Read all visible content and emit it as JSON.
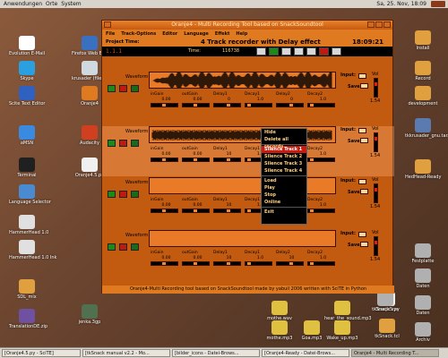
{
  "topbar": {
    "menus": [
      "Anwendungen",
      "Orte",
      "System"
    ],
    "clock": "Sa, 25. Nov, 18:09"
  },
  "desktop_icons": [
    {
      "label": "Evolution E-Mail",
      "color": "#ffffff"
    },
    {
      "label": "Skype",
      "color": "#2aa0e0"
    },
    {
      "label": "Scite Text Editor",
      "color": "#3060c0"
    },
    {
      "label": "aMSN",
      "color": "#3a8ae0"
    },
    {
      "label": "Terminal",
      "color": "#202020"
    },
    {
      "label": "Language Selector",
      "color": "#4a8ad0"
    },
    {
      "label": "HammerHead 1.0",
      "color": "#e0e0e0"
    },
    {
      "label": "HammerHead 1.0 Ink",
      "color": "#e0e0e0"
    },
    {
      "label": "SDL_mix",
      "color": "#e0a040"
    },
    {
      "label": "TranslationDE.zip",
      "color": "#7050a0"
    },
    {
      "label": "Firefox Web Browser",
      "color": "#3a70c0"
    },
    {
      "label": "krusader (file Manager)",
      "color": "#d0d8e0"
    },
    {
      "label": "Oranje4",
      "color": "#e07a20"
    },
    {
      "label": "Audacity",
      "color": "#d04020"
    },
    {
      "label": "Oranje4.5.py",
      "color": "#f0f0f0"
    },
    {
      "label": "jenka.3gp",
      "color": "#507050"
    },
    {
      "label": "Install",
      "color": "#e0a040"
    },
    {
      "label": "Record",
      "color": "#e0a040"
    },
    {
      "label": "development",
      "color": "#e0a040"
    },
    {
      "label": "tkkrusader_gnu.tar.gz",
      "color": "#5a7ab0"
    },
    {
      "label": "HedHead-Ready",
      "color": "#e0a040"
    },
    {
      "label": "Festplatte",
      "color": "#b0b0b0"
    },
    {
      "label": "Daten",
      "color": "#b0b0b0"
    },
    {
      "label": "Daten",
      "color": "#b0b0b0"
    },
    {
      "label": "Archiv",
      "color": "#b0b0b0"
    },
    {
      "label": "Oranje5.py",
      "color": "#f0f0f0"
    },
    {
      "label": "tkSnack.tcl",
      "color": "#e0a040"
    },
    {
      "label": "mothe.wav",
      "color": "#e0c040"
    },
    {
      "label": "hear_the_sound.mp3",
      "color": "#e0c040"
    },
    {
      "label": "mothe.mp3",
      "color": "#e0c040"
    },
    {
      "label": "Goa.mp3",
      "color": "#e0c040"
    },
    {
      "label": "Wake_up.mp3",
      "color": "#e0c040"
    },
    {
      "label": "tkSnack.sys",
      "color": "#b0b0b0"
    }
  ],
  "window": {
    "title": "Oranje4 - Multi Recording Tool based on SnackSoundtool",
    "menus": [
      "File",
      "Track-Options",
      "Editor",
      "Language",
      "Effekt",
      "Help"
    ],
    "project_label": "Project Time:",
    "heading": "4 Track recorder with Delay effect",
    "clock": "18:09:21",
    "transport": {
      "segment": "1.1.1",
      "time_label": "Time:",
      "time_value": "116738"
    },
    "param_labels": [
      "inGain",
      "outGain",
      "Delay1",
      "Decay1",
      "Delay2",
      "Decay2"
    ],
    "input_label": "Input:",
    "save_label": "Save:",
    "vol_label": "Vol",
    "tracks": [
      {
        "name": "Waveform 1",
        "params": [
          "0.00",
          "0.00",
          "0",
          "1.0",
          "0",
          "1.0"
        ],
        "vol": "1.54"
      },
      {
        "name": "Waveform 2",
        "params": [
          "0.00",
          "0.00",
          "10",
          "1.0",
          "10",
          "1.0"
        ],
        "vol": "1.54"
      },
      {
        "name": "Waveform 3",
        "params": [
          "0.00",
          "0.00",
          "10",
          "1.0",
          "10",
          "1.0"
        ],
        "vol": "1.54"
      },
      {
        "name": "Waveform 4",
        "params": [
          "0.00",
          "0.00",
          "10",
          "1.0",
          "10",
          "1.0"
        ],
        "vol": "1.54"
      }
    ],
    "status": "Oranje4-Multi Recording tool based on SnackSoundtool made by yabuil 2006  written with SciTE in Python"
  },
  "context_menu": {
    "items": [
      "Hide",
      "Delete all records",
      "Silence Track 1",
      "Silence Track 2",
      "Silence Track 3",
      "Silence Track 4",
      "Load",
      "Play",
      "Stop",
      "Online",
      "Exit"
    ],
    "highlighted": "Silence Track 1"
  },
  "taskbar": [
    "[Oranje4.5.py - SciTE]",
    "[tkSnack manual v2.2 - Mo...",
    "[bilder_icons - Datei-Brows...",
    "[Oranje4-Ready - Datei-Brows...",
    "Oranje4 - Multi Recording T..."
  ],
  "colors": {
    "window_bg": "#c25a10",
    "accent": "#e07a20",
    "highlight": "#c81c10"
  }
}
